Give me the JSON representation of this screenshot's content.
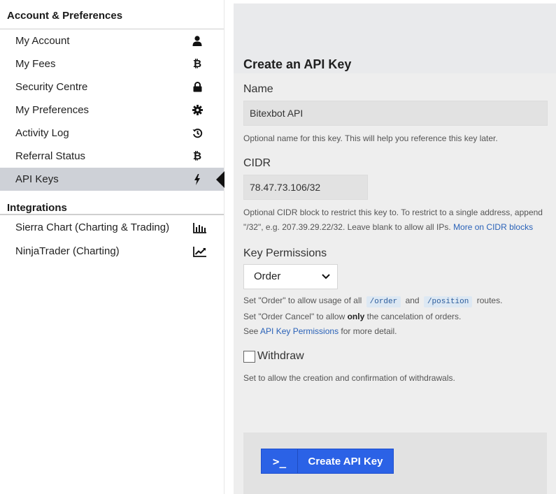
{
  "sidebar": {
    "account_section_title": "Account & Preferences",
    "items": [
      {
        "label": "My Account",
        "icon": "user-icon",
        "glyph": "👤"
      },
      {
        "label": "My Fees",
        "icon": "bitcoin-icon",
        "glyph": "₿"
      },
      {
        "label": "Security Centre",
        "icon": "lock-icon",
        "glyph": "🔒"
      },
      {
        "label": "My Preferences",
        "icon": "gear-icon",
        "glyph": "⚙"
      },
      {
        "label": "Activity Log",
        "icon": "history-icon",
        "glyph": "⟲"
      },
      {
        "label": "Referral Status",
        "icon": "bitcoin-icon",
        "glyph": "₿"
      },
      {
        "label": "API Keys",
        "icon": "bolt-icon",
        "glyph": "ϟ",
        "active": true
      }
    ],
    "integrations_section_title": "Integrations",
    "integrations": [
      {
        "label": "Sierra Chart (Charting & Trading)",
        "icon": "bar-chart-icon"
      },
      {
        "label": "NinjaTrader (Charting)",
        "icon": "line-chart-icon"
      }
    ]
  },
  "form": {
    "title": "Create an API Key",
    "name_label": "Name",
    "name_value": "Bitexbot API",
    "name_help": "Optional name for this key. This will help you reference this key later.",
    "cidr_label": "CIDR",
    "cidr_value": "78.47.73.106/32",
    "cidr_help_pre": "Optional CIDR block to restrict this key to. To restrict to a single address, append \"/32\", e.g. 207.39.29.22/32. Leave blank to allow all IPs.",
    "cidr_help_link": "More on CIDR blocks",
    "permissions_label": "Key Permissions",
    "permissions_value": "Order",
    "perm_help_1a": "Set \"Order\" to allow usage of all",
    "perm_code_1": "/order",
    "perm_help_1b": "and",
    "perm_code_2": "/position",
    "perm_help_1c": "routes.",
    "perm_help_2a": "Set \"Order Cancel\" to allow",
    "perm_help_2b": "only",
    "perm_help_2c": "the cancelation of orders.",
    "perm_help_3a": "See",
    "perm_help_3_link": "API Key Permissions",
    "perm_help_3b": "for more detail.",
    "withdraw_label": "Withdraw",
    "withdraw_help": "Set to allow the creation and confirmation of withdrawals.",
    "submit_label": "Create API Key",
    "submit_icon": ">_"
  },
  "colors": {
    "accent": "#2b62e6",
    "link": "#2a62b8",
    "active_nav": "#ced1d7"
  }
}
